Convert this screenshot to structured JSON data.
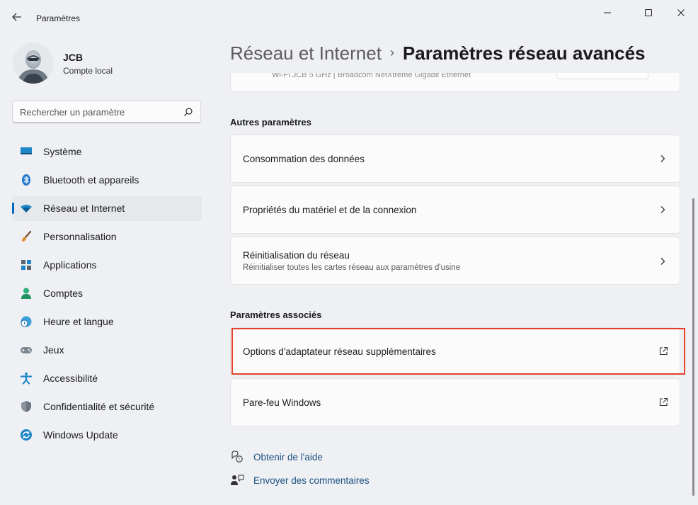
{
  "window": {
    "title": "Paramètres"
  },
  "profile": {
    "name": "JCB",
    "account_type": "Compte local"
  },
  "search": {
    "placeholder": "Rechercher un paramètre"
  },
  "nav": [
    {
      "label": "Système",
      "icon": "monitor-icon"
    },
    {
      "label": "Bluetooth et appareils",
      "icon": "bluetooth-icon"
    },
    {
      "label": "Réseau et Internet",
      "icon": "wifi-icon",
      "active": true
    },
    {
      "label": "Personnalisation",
      "icon": "brush-icon"
    },
    {
      "label": "Applications",
      "icon": "apps-icon"
    },
    {
      "label": "Comptes",
      "icon": "person-icon"
    },
    {
      "label": "Heure et langue",
      "icon": "globe-clock-icon"
    },
    {
      "label": "Jeux",
      "icon": "gamepad-icon"
    },
    {
      "label": "Accessibilité",
      "icon": "accessibility-icon"
    },
    {
      "label": "Confidentialité et sécurité",
      "icon": "shield-icon"
    },
    {
      "label": "Windows Update",
      "icon": "update-icon"
    }
  ],
  "breadcrumb": {
    "parent": "Réseau et Internet",
    "separator": "›",
    "current": "Paramètres réseau avancés"
  },
  "partial_card": {
    "text": "Wi-Fi JCB 5 GHz | Broadcom NetXtreme Gigabit Ethernet"
  },
  "sections": {
    "other": {
      "title": "Autres paramètres",
      "items": [
        {
          "title": "Consommation des données"
        },
        {
          "title": "Propriétés du matériel et de la connexion"
        },
        {
          "title": "Réinitialisation du réseau",
          "subtitle": "Réinitialiser toutes les cartes réseau aux paramètres d'usine"
        }
      ]
    },
    "related": {
      "title": "Paramètres associés",
      "items": [
        {
          "title": "Options d'adaptateur réseau supplémentaires"
        },
        {
          "title": "Pare-feu Windows"
        }
      ]
    }
  },
  "help": {
    "get_help": "Obtenir de l'aide",
    "feedback": "Envoyer des commentaires"
  },
  "colors": {
    "accent": "#0067c0",
    "highlight": "#e5432d",
    "link": "#1a4f80"
  }
}
